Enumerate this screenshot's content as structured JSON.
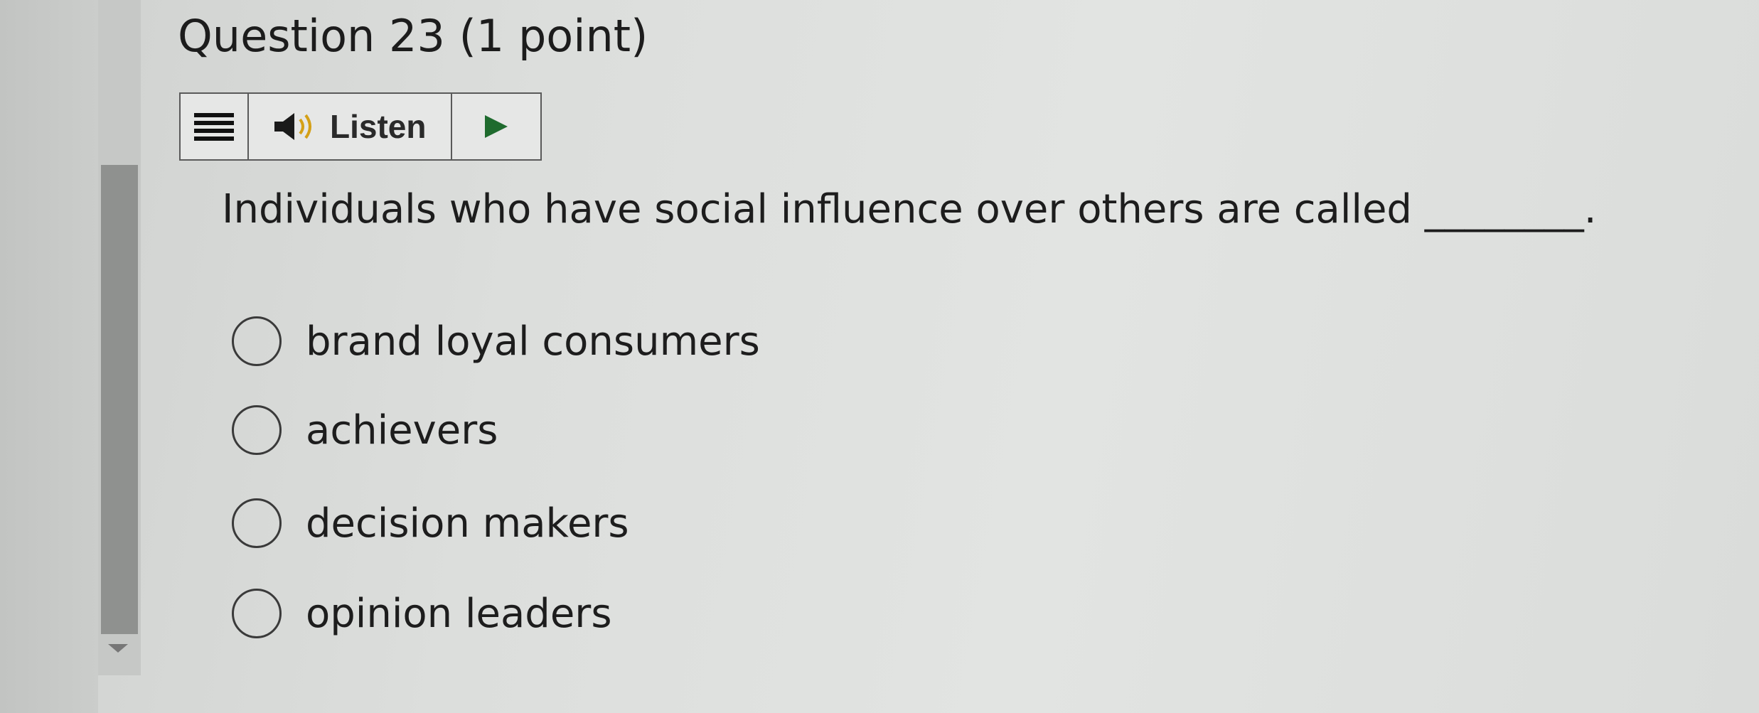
{
  "question": {
    "title": "Question 23 (1 point)",
    "text": "Individuals who have social influence over others are called ________."
  },
  "toolbar": {
    "listen_label": "Listen",
    "menu_icon": "menu-icon",
    "speaker_icon": "speaker-icon",
    "play_icon": "play-icon"
  },
  "options": [
    {
      "label": "brand loyal consumers",
      "selected": false
    },
    {
      "label": "achievers",
      "selected": false
    },
    {
      "label": "decision makers",
      "selected": false
    },
    {
      "label": "opinion leaders",
      "selected": false
    }
  ]
}
